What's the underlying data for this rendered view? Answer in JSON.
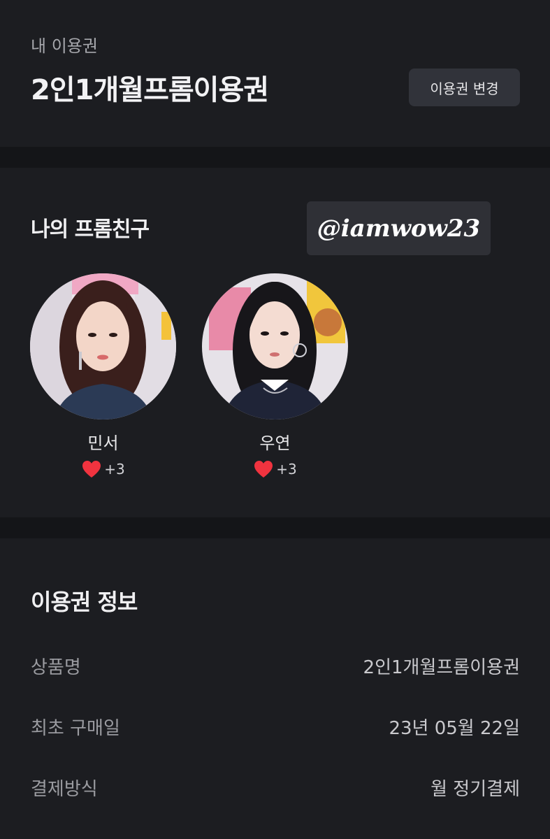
{
  "plan": {
    "label": "내 이용권",
    "title": "2인1개월프롬이용권",
    "change_button": "이용권 변경"
  },
  "friends": {
    "title": "나의 프롬친구",
    "watermark": "@iamwow23",
    "items": [
      {
        "name": "민서",
        "likes": "+3"
      },
      {
        "name": "우연",
        "likes": "+3"
      }
    ]
  },
  "info": {
    "title": "이용권 정보",
    "rows": [
      {
        "key": "상품명",
        "value": "2인1개월프롬이용권"
      },
      {
        "key": "최초 구매일",
        "value": "23년 05월 22일"
      },
      {
        "key": "결제방식",
        "value": "월 정기결제"
      }
    ]
  },
  "colors": {
    "background": "#1c1d21",
    "divider": "#141518",
    "button": "#31333a",
    "heart": "#f0333f"
  },
  "icons": {
    "like": "heart-icon"
  }
}
